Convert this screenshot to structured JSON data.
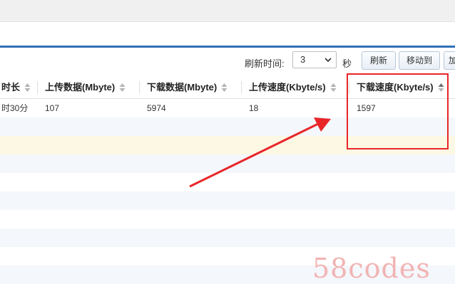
{
  "toolbar": {
    "refresh_interval_label": "刷新时间:",
    "refresh_interval_value": "3",
    "seconds_label": "秒",
    "refresh_button": "刷新",
    "move_to_button": "移动到",
    "more_button_fragment": "加"
  },
  "table": {
    "columns": [
      "时长",
      "上传数据(Mbyte)",
      "下载数据(Mbyte)",
      "上传速度(Kbyte/s)",
      "下载速度(Kbyte/s)"
    ],
    "rows": [
      [
        "时30分",
        "107",
        "5974",
        "18",
        "1597"
      ]
    ]
  },
  "watermark": "58codes",
  "colors": {
    "accent_blue": "#2f6fb6",
    "highlight_red": "#e8262a",
    "selected_row": "#fdf8e4",
    "striped_row": "#f4f7fb"
  }
}
